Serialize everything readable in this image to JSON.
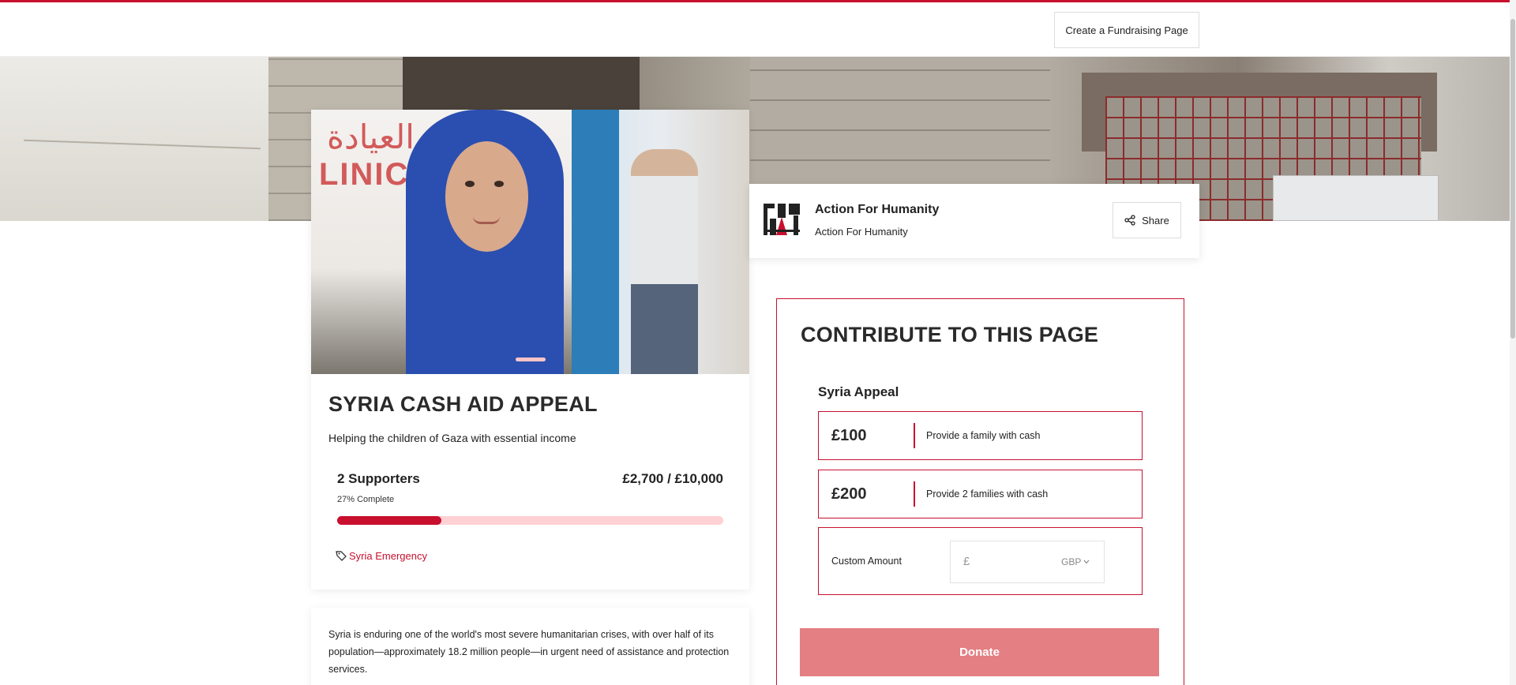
{
  "header": {
    "create_page_label": "Create a Fundraising Page"
  },
  "campaign": {
    "title": "SYRIA CASH AID APPEAL",
    "subtitle": "Helping the children of Gaza with essential income",
    "supporters": "2 Supporters",
    "raised_of_target": "£2,700 / £10,000",
    "complete_text": "27% Complete",
    "progress_percent": 27,
    "tag": "Syria Emergency",
    "description": "Syria is enduring one of the world's most severe humanitarian crises, with over half of its population—approximately 18.2 million people—in urgent need of assistance and protection services."
  },
  "charity": {
    "name": "Action For Humanity",
    "subname": "Action For Humanity",
    "share_label": "Share"
  },
  "contribute": {
    "title": "CONTRIBUTE TO THIS PAGE",
    "appeal_name": "Syria Appeal",
    "options": [
      {
        "amount": "£100",
        "label": "Provide a family with cash"
      },
      {
        "amount": "£200",
        "label": "Provide 2 families with cash"
      }
    ],
    "custom_label": "Custom Amount",
    "currency_symbol": "£",
    "currency": "GBP",
    "donate_label": "Donate"
  },
  "colors": {
    "accent": "#c8102e",
    "progress_track": "#ffd1d4",
    "donate_bg": "#e47f83"
  }
}
